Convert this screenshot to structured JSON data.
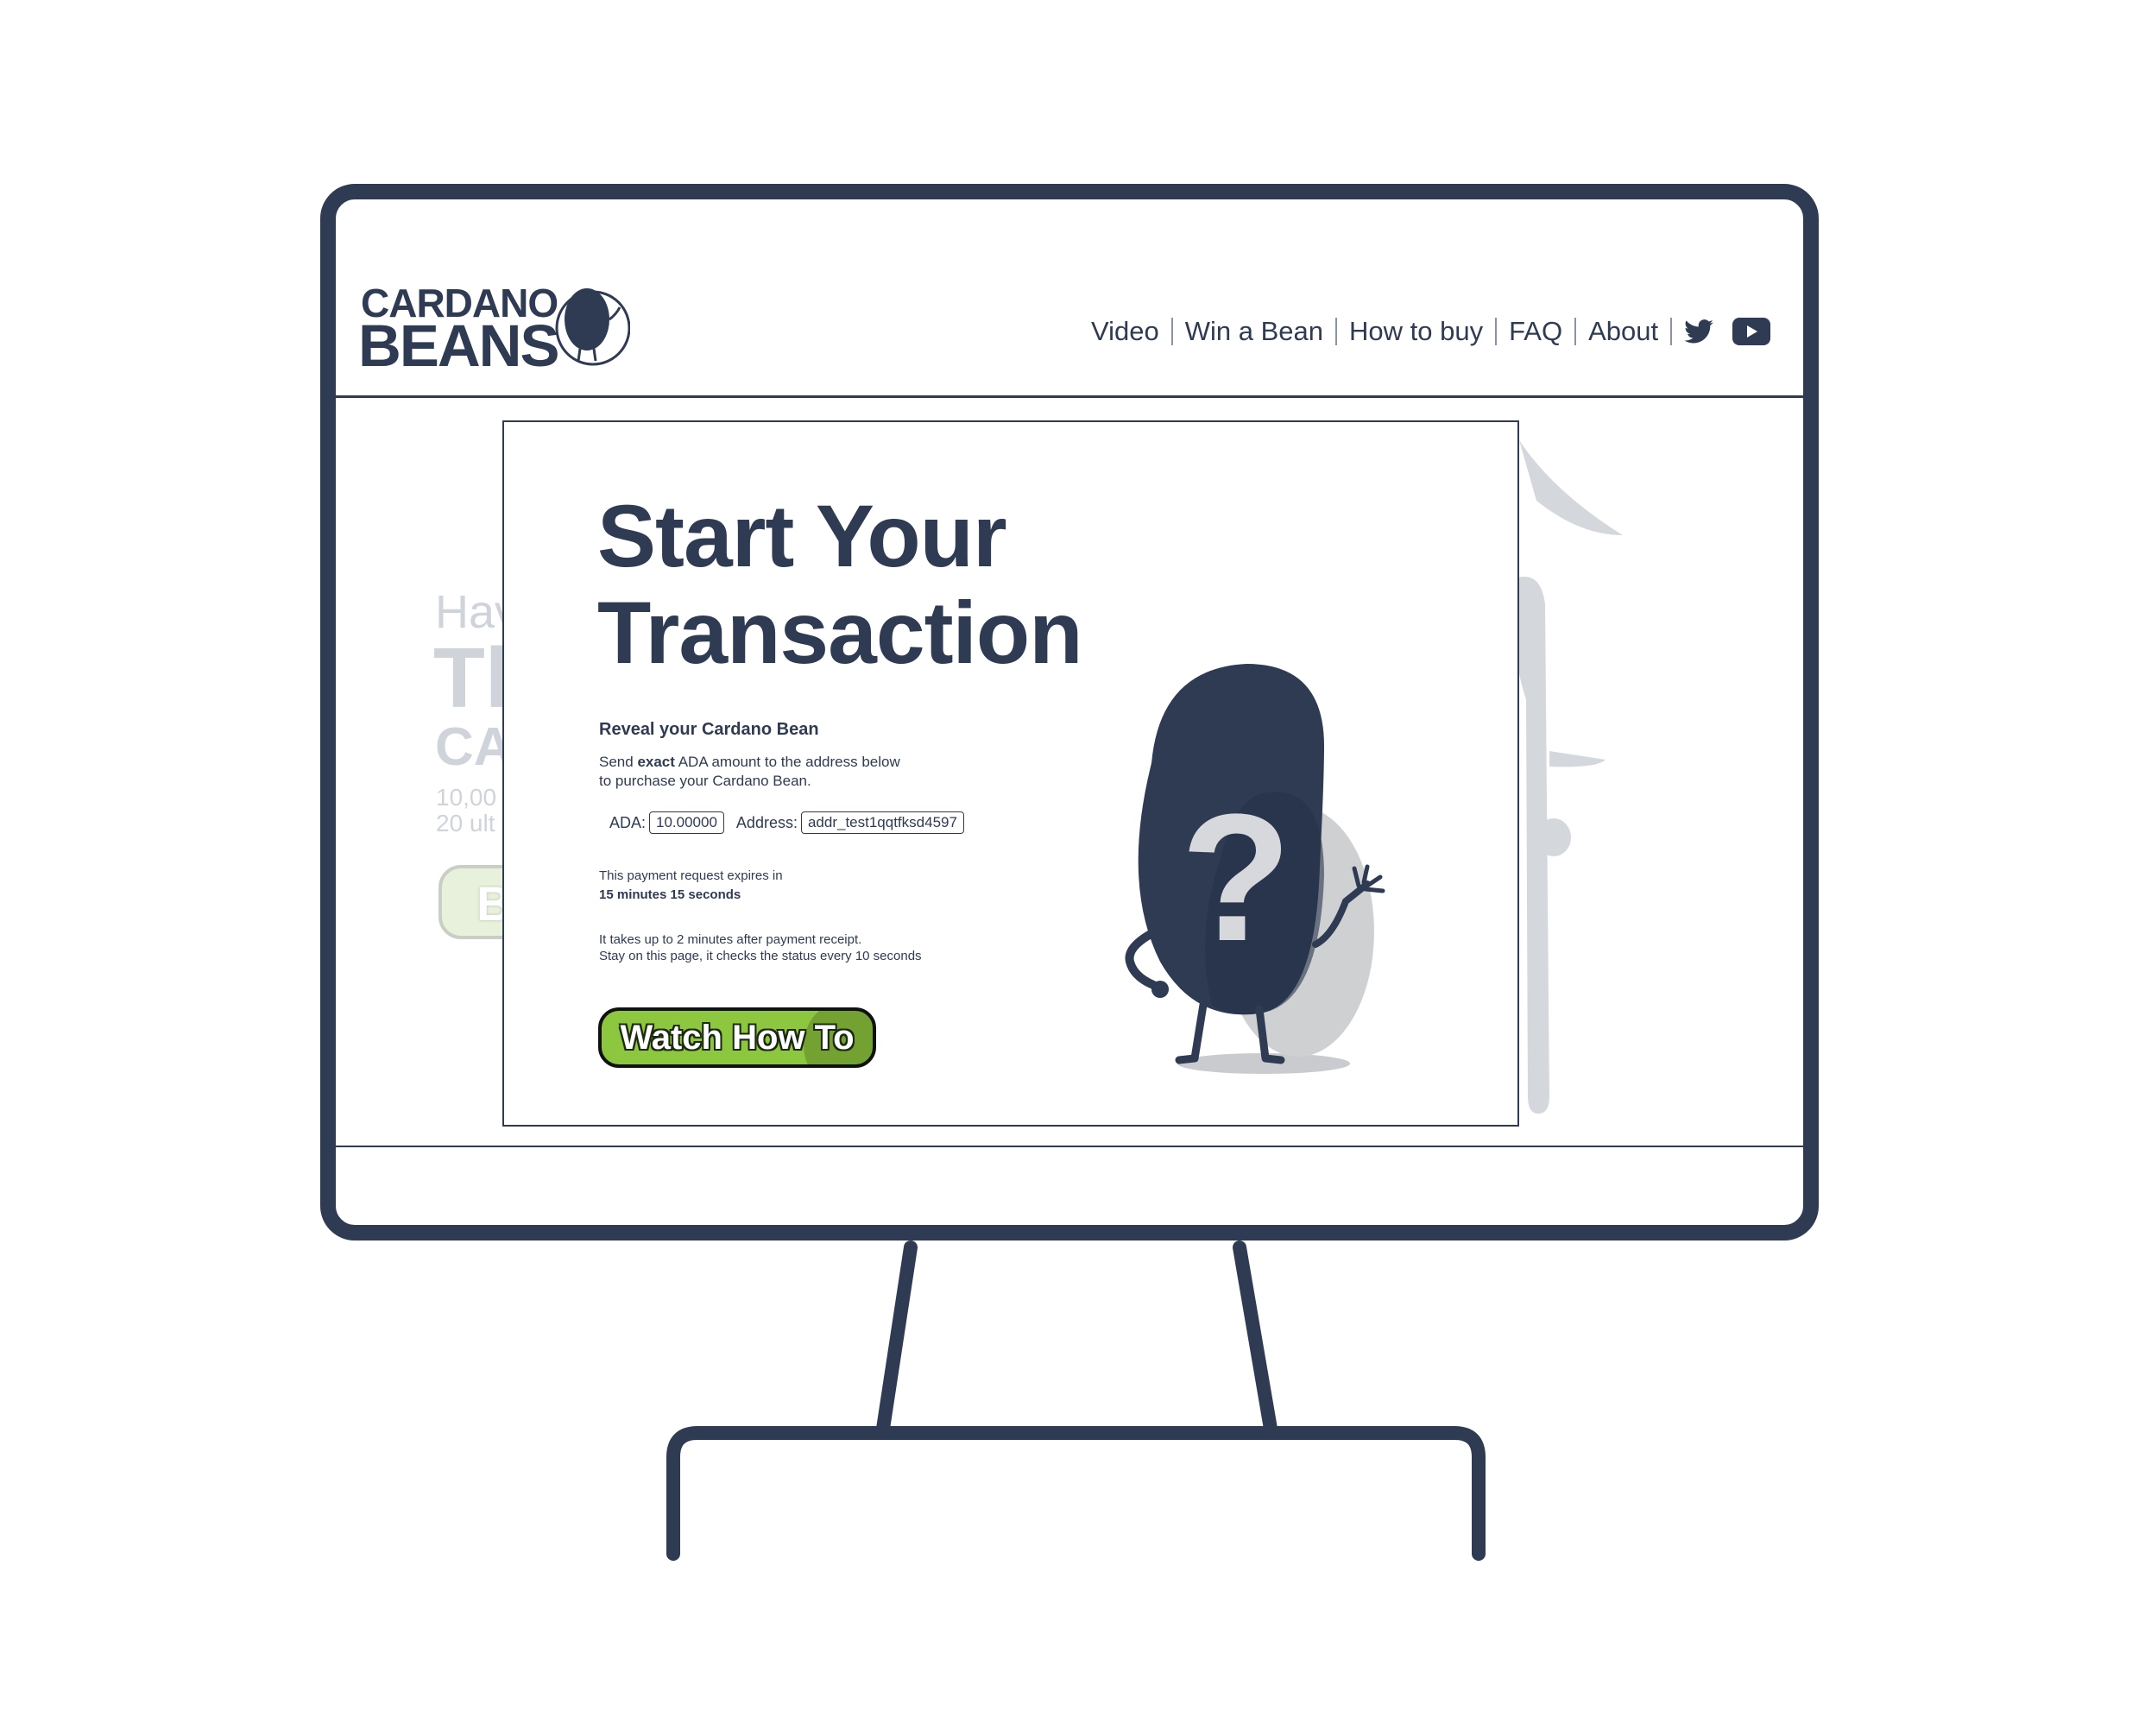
{
  "brand": {
    "logo_line1": "CARDANO",
    "logo_line2": "BEANS",
    "primary_color": "#2f3b53",
    "accent_color": "#8dc63f"
  },
  "nav": {
    "items": [
      {
        "label": "Video"
      },
      {
        "label": "Win a Bean"
      },
      {
        "label": "How to buy"
      },
      {
        "label": "FAQ"
      },
      {
        "label": "About"
      }
    ],
    "social_icons": [
      "twitter-icon",
      "youtube-icon"
    ]
  },
  "background_page": {
    "line_have": "Hav",
    "big_text": "Tl",
    "sub_text": "CA",
    "stat1": "10,00",
    "stat2": "20 ult",
    "button_label": "B"
  },
  "modal": {
    "title_line1": "Start Your",
    "title_line2": "Transaction",
    "subtitle": "Reveal your Cardano Bean",
    "instruction_prefix": "Send ",
    "instruction_bold": "exact",
    "instruction_rest1": " ADA amount to the address below",
    "instruction_rest2": "to purchase your Cardano Bean.",
    "ada_label": "ADA:",
    "ada_value": "10.00000",
    "address_label": "Address:",
    "address_value": "addr_test1qqtfksd4597",
    "expiry_label": "This payment request expires in",
    "expiry_time": "15 minutes 15 seconds",
    "note_line1": "It takes up to 2 minutes after payment receipt.",
    "note_line2": "Stay on this page, it checks the status every 10 seconds",
    "watch_button_label": "Watch How To",
    "mystery_icon": "question-mark-bean-icon"
  }
}
